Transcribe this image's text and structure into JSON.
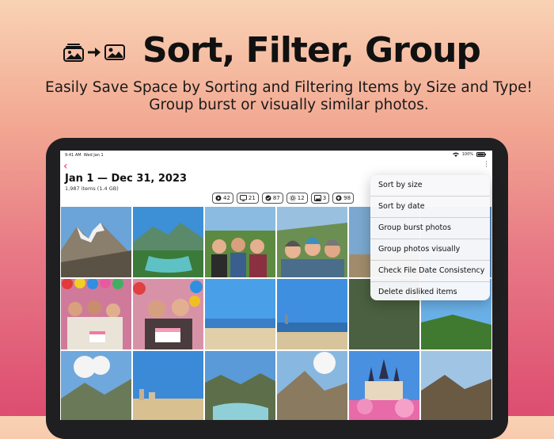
{
  "hero": {
    "title": "Sort, Filter, Group",
    "subtitle_line1": "Easily Save Space by Sorting and Filtering Items by Size and Type!",
    "subtitle_line2": "Group burst or visually similar photos."
  },
  "status_bar": {
    "time": "9:41 AM",
    "date": "Wed Jan 1",
    "battery": "100%"
  },
  "header": {
    "title": "Jan 1 — Dec 31, 2023",
    "subtitle": "1,987 items (1.4 GB)"
  },
  "filters": [
    {
      "icon": "play-icon",
      "count": "42"
    },
    {
      "icon": "screen-icon",
      "count": "21"
    },
    {
      "icon": "check-icon",
      "count": "87"
    },
    {
      "icon": "live-icon",
      "count": "12"
    },
    {
      "icon": "photo-icon",
      "count": "3"
    },
    {
      "icon": "thumbs-down-icon",
      "count": "98"
    }
  ],
  "menu": {
    "items": [
      "Sort by size",
      "Sort by date",
      "Group burst photos",
      "Group photos visually",
      "Check File Date Consistency",
      "Delete disliked items"
    ]
  }
}
